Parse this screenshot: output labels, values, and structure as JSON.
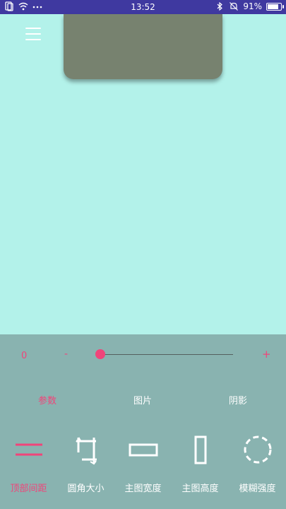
{
  "status_bar": {
    "time": "13:52",
    "battery_text": "91%",
    "battery_level": 0.91,
    "left_icons": [
      "sim-icon",
      "wifi-icon",
      "more-dots-icon"
    ],
    "right_icons": [
      "bluetooth-icon",
      "mute-icon",
      "battery-icon"
    ]
  },
  "header": {
    "menu_icon": "hamburger-menu-icon"
  },
  "preview": {
    "card_color": "#77826f",
    "background_color": "#b3f2ea"
  },
  "slider": {
    "value_text": "0",
    "minus_label": "-",
    "plus_label": "+",
    "fraction": 0.0,
    "accent_color": "#f0457a"
  },
  "tabs": [
    {
      "label": "参数",
      "active": true
    },
    {
      "label": "图片",
      "active": false
    },
    {
      "label": "阴影",
      "active": false
    }
  ],
  "tools": [
    {
      "label": "顶部间距",
      "icon": "top-spacing-icon",
      "active": true
    },
    {
      "label": "圆角大小",
      "icon": "corner-radius-icon",
      "active": false
    },
    {
      "label": "主图宽度",
      "icon": "width-icon",
      "active": false
    },
    {
      "label": "主图高度",
      "icon": "height-icon",
      "active": false
    },
    {
      "label": "模糊强度",
      "icon": "blur-icon",
      "active": false
    }
  ]
}
